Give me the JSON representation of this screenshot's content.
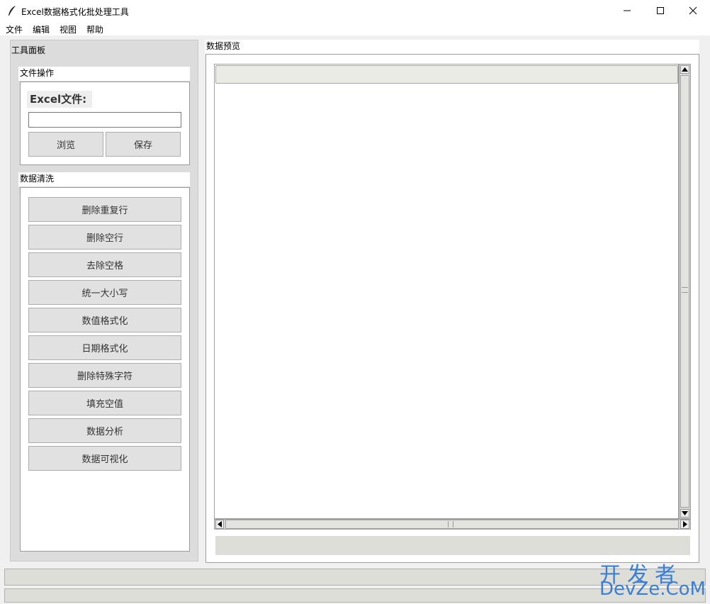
{
  "window": {
    "title": "Excel数据格式化批处理工具",
    "controls": {
      "minimize": "—",
      "maximize": "☐",
      "close": "✕"
    }
  },
  "menu": [
    "文件",
    "编辑",
    "视图",
    "帮助"
  ],
  "left_panel": {
    "title": "工具面板",
    "file_ops": {
      "title": "文件操作",
      "excel_label": "Excel文件:",
      "path_value": "",
      "browse_label": "浏览",
      "save_label": "保存"
    },
    "cleaning": {
      "title": "数据清洗",
      "buttons": [
        "删除重复行",
        "删除空行",
        "去除空格",
        "统一大小写",
        "数值格式化",
        "日期格式化",
        "删除特殊字符",
        "填充空值",
        "数据分析",
        "数据可视化"
      ]
    }
  },
  "right_panel": {
    "title": "数据预览"
  },
  "watermark": {
    "cn": "开发者",
    "en": "DevZe.CoM"
  },
  "icons": {
    "app": "feather-icon",
    "scroll_up": "arrow-up-icon",
    "scroll_down": "arrow-down-icon",
    "scroll_left": "arrow-left-icon",
    "scroll_right": "arrow-right-icon"
  }
}
